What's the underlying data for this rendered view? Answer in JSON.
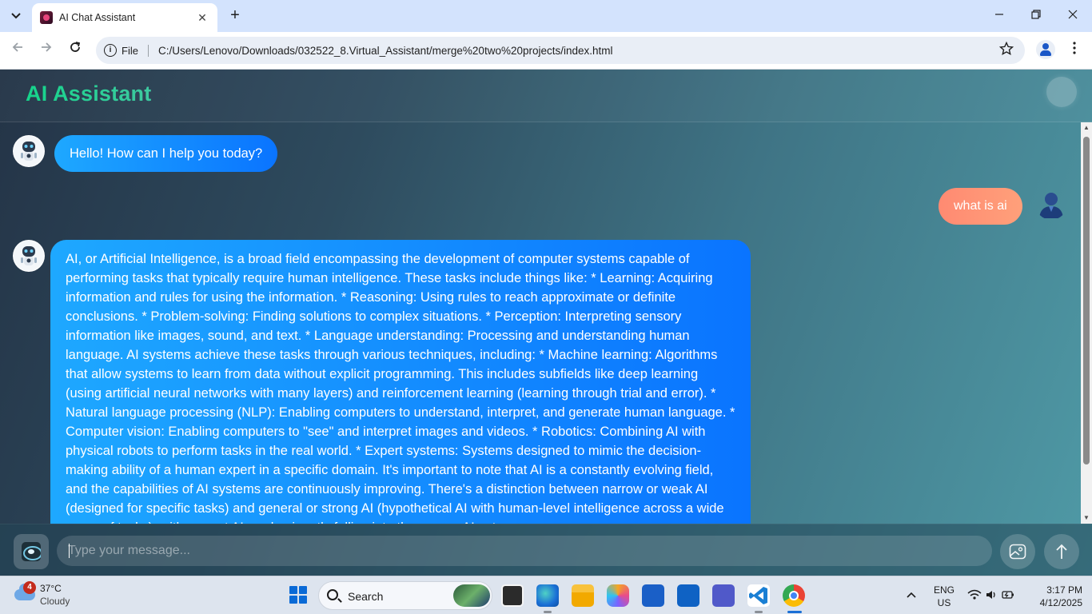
{
  "browser": {
    "tab_title": "AI Chat Assistant",
    "new_tab": "+",
    "file_label": "File",
    "url": "C:/Users/Lenovo/Downloads/032522_8.Virtual_Assistant/merge%20two%20projects/index.html"
  },
  "app": {
    "title": "AI Assistant",
    "messages": [
      {
        "role": "bot",
        "text": "Hello! How can I help you today?"
      },
      {
        "role": "user",
        "text": "what is ai"
      },
      {
        "role": "bot",
        "text": "AI, or Artificial Intelligence, is a broad field encompassing the development of computer systems capable of performing tasks that typically require human intelligence. These tasks include things like: * Learning: Acquiring information and rules for using the information. * Reasoning: Using rules to reach approximate or definite conclusions. * Problem-solving: Finding solutions to complex situations. * Perception: Interpreting sensory information like images, sound, and text. * Language understanding: Processing and understanding human language. AI systems achieve these tasks through various techniques, including: * Machine learning: Algorithms that allow systems to learn from data without explicit programming. This includes subfields like deep learning (using artificial neural networks with many layers) and reinforcement learning (learning through trial and error). * Natural language processing (NLP): Enabling computers to understand, interpret, and generate human language. * Computer vision: Enabling computers to \"see\" and interpret images and videos. * Robotics: Combining AI with physical robots to perform tasks in the real world. * Expert systems: Systems designed to mimic the decision-making ability of a human expert in a specific domain. It's important to note that AI is a constantly evolving field, and the capabilities of AI systems are continuously improving. There's a distinction between narrow or weak AI (designed for specific tasks) and general or strong AI (hypothetical AI with human-level intelligence across a wide range of tasks), with current AI predominantly falling into the narrow AI category."
      }
    ],
    "input": {
      "placeholder": "Type your message...",
      "value": ""
    }
  },
  "taskbar": {
    "weather_badge": "4",
    "weather_temp": "37°C",
    "weather_condition": "Cloudy",
    "search_label": "Search",
    "lang_line1": "ENG",
    "lang_line2": "US",
    "time": "3:17 PM",
    "date": "4/12/2025"
  },
  "colors": {
    "accent_title": "#15d58b",
    "bot_bubble": "#0a74ff",
    "user_bubble": "#ffa07a"
  },
  "icons": {
    "tab_list": "chevron-down-icon",
    "back": "arrow-left-icon",
    "forward": "arrow-right-icon",
    "reload": "reload-icon",
    "site_info": "info-icon",
    "bookmark": "star-icon",
    "profile": "profile-icon",
    "menu": "kebab-menu-icon",
    "attach": "image-icon",
    "send": "arrow-up-icon"
  }
}
